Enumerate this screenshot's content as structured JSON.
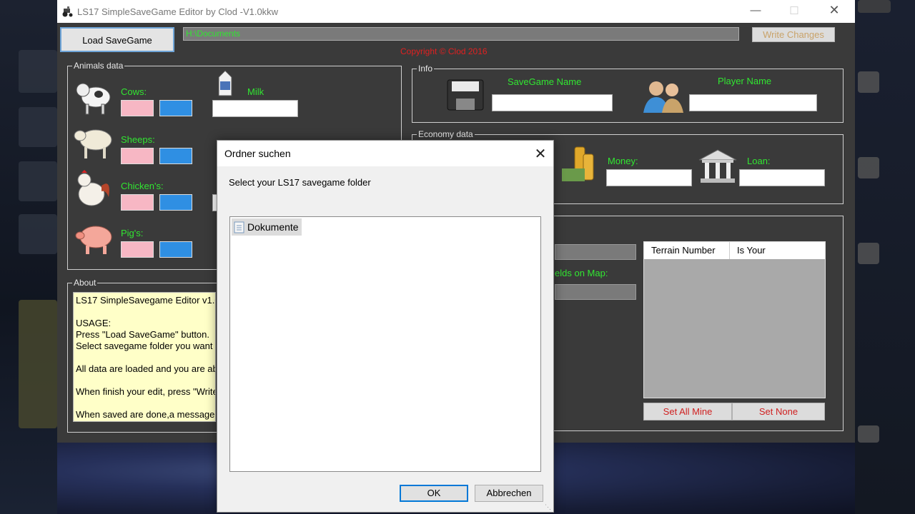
{
  "window": {
    "title": "LS17 SimpleSaveGame Editor by Clod -V1.0kkw"
  },
  "toolbar": {
    "load_label": "Load SaveGame",
    "path_value": "H:\\Documents",
    "write_label": "Write Changes",
    "copyright": "Copyright © Clod 2016"
  },
  "animals": {
    "group_title": "Animals data",
    "cows_label": "Cows:",
    "sheeps_label": "Sheeps:",
    "chickens_label": "Chicken's:",
    "pigs_label": "Pig's:",
    "milk_label": "Milk"
  },
  "info": {
    "group_title": "Info",
    "savegame_name_label": "SaveGame Name",
    "player_name_label": "Player Name"
  },
  "economy": {
    "group_title": "Economy data",
    "money_label": "Money:",
    "loan_label": "Loan:"
  },
  "fields": {
    "fields_on_map_label": "elds on Map:",
    "col_terrain": "Terrain Number",
    "col_is_your": "Is Your",
    "set_all_label": "Set All Mine",
    "set_none_label": "Set None"
  },
  "about": {
    "group_title": "About",
    "text": "LS17 SimpleSavegame Editor v1.0\n\nUSAGE:\nPress \"Load SaveGame\" button.\nSelect savegame folder you want t\n\nAll data are loaded and you are ab\n\nWhen finish your edit, press \"Write\n\nWhen saved are done,a message"
  },
  "dialog": {
    "title": "Ordner suchen",
    "message": "Select your LS17 savegame folder",
    "tree_item": "Dokumente",
    "ok_label": "OK",
    "cancel_label": "Abbrechen"
  },
  "colors": {
    "accent_green": "#31e631",
    "copyright_red": "#e02020",
    "window_bg": "#3a3a3a"
  }
}
